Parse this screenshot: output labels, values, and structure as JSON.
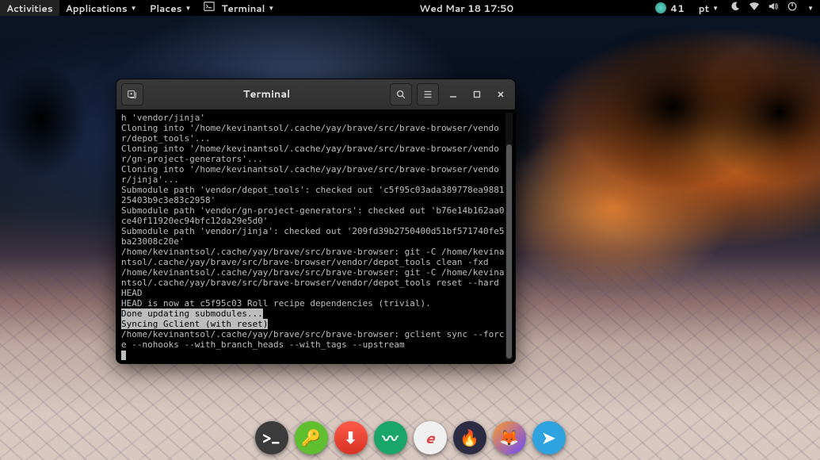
{
  "panel": {
    "activities": "Activities",
    "applications": "Applications",
    "places": "Places",
    "terminal": "Terminal",
    "clock": "Wed Mar 18  17:50",
    "temp_value": "41",
    "keyboard": "pt"
  },
  "window": {
    "title": "Terminal"
  },
  "terminal": {
    "lines": [
      "h 'vendor/jinja'",
      "Cloning into '/home/kevinantsol/.cache/yay/brave/src/brave-browser/vendor/depot_tools'...",
      "Cloning into '/home/kevinantsol/.cache/yay/brave/src/brave-browser/vendor/gn-project-generators'...",
      "Cloning into '/home/kevinantsol/.cache/yay/brave/src/brave-browser/vendor/jinja'...",
      "Submodule path 'vendor/depot_tools': checked out 'c5f95c03ada389778ea988125403b9c3e83c2958'",
      "Submodule path 'vendor/gn-project-generators': checked out 'b76e14b162aa0ce40f11920ec94bfc12da29e5d0'",
      "Submodule path 'vendor/jinja': checked out '209fd39b2750400d51bf571740fe5ba23008c20e'",
      "/home/kevinantsol/.cache/yay/brave/src/brave-browser: git -C /home/kevinantsol/.cache/yay/brave/src/brave-browser/vendor/depot_tools clean -fxd",
      "/home/kevinantsol/.cache/yay/brave/src/brave-browser: git -C /home/kevinantsol/.cache/yay/brave/src/brave-browser/vendor/depot_tools reset --hard HEAD",
      "HEAD is now at c5f95c03 Roll recipe dependencies (trivial)."
    ],
    "highlight1": "Done updating submodules...",
    "highlight2": "Syncing Gclient (with reset)",
    "tail": "/home/kevinantsol/.cache/yay/brave/src/brave-browser: gclient sync --force --nohooks --with_branch_heads --with_tags --upstream"
  },
  "dock": {
    "items": [
      {
        "name": "terminal",
        "bg": "#3b3b3b",
        "glyph": ">_"
      },
      {
        "name": "keepass",
        "bg": "#5fbf2f",
        "glyph": "🔑"
      },
      {
        "name": "updater",
        "bg": "linear-gradient(#ff5a4a,#d63324)",
        "glyph": "⬇"
      },
      {
        "name": "monitor",
        "bg": "#1aa56b",
        "glyph": "〰"
      },
      {
        "name": "epiphany",
        "bg": "#f0f0f0",
        "glyph": "e"
      },
      {
        "name": "flame",
        "bg": "#2b2b44",
        "glyph": "🔥"
      },
      {
        "name": "firefox",
        "bg": "linear-gradient(135deg,#ff9a2a,#6a4aff)",
        "glyph": "🦊"
      },
      {
        "name": "telegram",
        "bg": "#2fa3e0",
        "glyph": "➤"
      }
    ]
  }
}
